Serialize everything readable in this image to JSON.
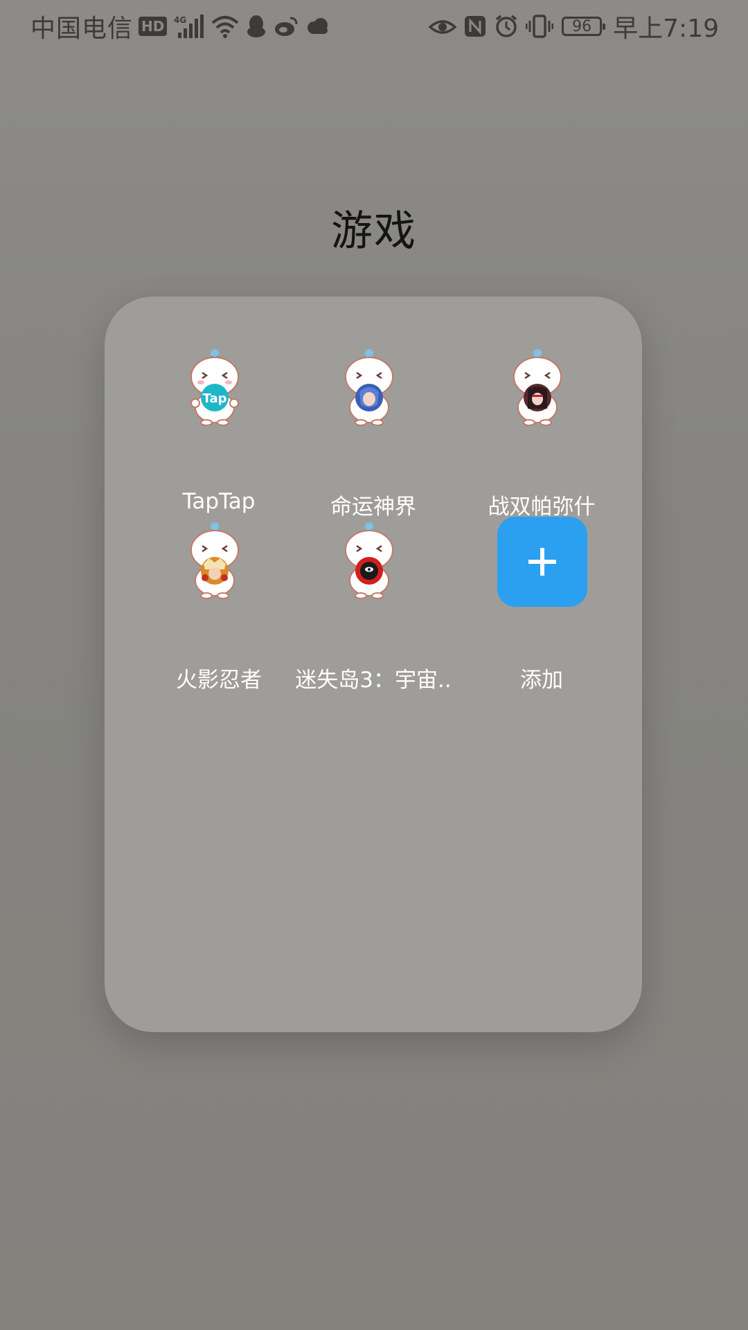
{
  "status_bar": {
    "carrier": "中国电信",
    "hd_badge": "HD",
    "network": "4G",
    "battery_level": "96",
    "time": "早上7:19",
    "left_icons": [
      "hd-badge-icon",
      "signal-4g-icon",
      "wifi-icon",
      "qq-icon",
      "weibo-icon",
      "cloud-icon"
    ],
    "right_icons": [
      "eye-icon",
      "nfc-icon",
      "alarm-icon",
      "vibrate-icon",
      "battery-icon"
    ]
  },
  "folder": {
    "title": "游戏",
    "apps": [
      {
        "label": "TapTap",
        "badge_text": "Tap",
        "badge_color": "#1fb6c8"
      },
      {
        "label": "命运神界",
        "badge_color": "#3b5fb4"
      },
      {
        "label": "战双帕弥什",
        "badge_color": "#5a2a2e"
      },
      {
        "label": "火影忍者",
        "badge_color": "#d98a2c"
      },
      {
        "label": "迷失岛3：宇宙..",
        "badge_color": "#d21e1e"
      }
    ],
    "add_tile": {
      "label": "添加",
      "icon": "plus-icon",
      "color": "#2b9ff0"
    }
  },
  "colors": {
    "background": "#858480",
    "folder_panel": "#9e9d9a",
    "label_text": "#ffffff",
    "title_text": "#141414"
  }
}
